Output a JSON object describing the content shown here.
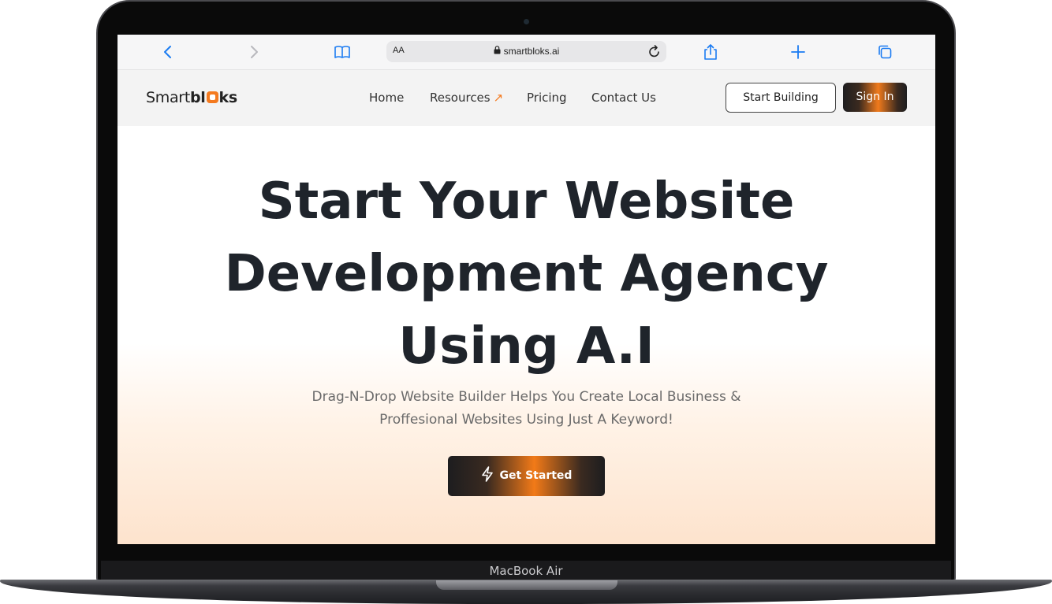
{
  "device": {
    "model_label": "MacBook Air"
  },
  "browser": {
    "url_aa": "AA",
    "url": "smartbloks.ai",
    "icons": [
      "back-icon",
      "forward-icon",
      "bookmarks-icon",
      "lock-icon",
      "reload-icon",
      "share-icon",
      "new-tab-icon",
      "tabs-icon"
    ]
  },
  "site": {
    "logo": {
      "prefix": "Smart",
      "bold_a": "bl",
      "bold_b": "ks"
    },
    "nav": {
      "home": "Home",
      "resources": "Resources",
      "resources_arrow": "↗",
      "pricing": "Pricing",
      "contact": "Contact Us"
    },
    "buttons": {
      "start_building": "Start Building",
      "sign_in": "Sign In"
    }
  },
  "hero": {
    "title_line1": "Start Your Website",
    "title_line2": "Development Agency",
    "title_line3": "Using A.I",
    "subtitle_line1": "Drag-N-Drop Website Builder Helps You Create Local Business &",
    "subtitle_line2": "Proffesional Websites Using Just A Keyword!",
    "cta": "Get Started"
  },
  "colors": {
    "accent": "#f47a1f",
    "dark": "#1f242b",
    "link_blue": "#1a7bf2"
  }
}
